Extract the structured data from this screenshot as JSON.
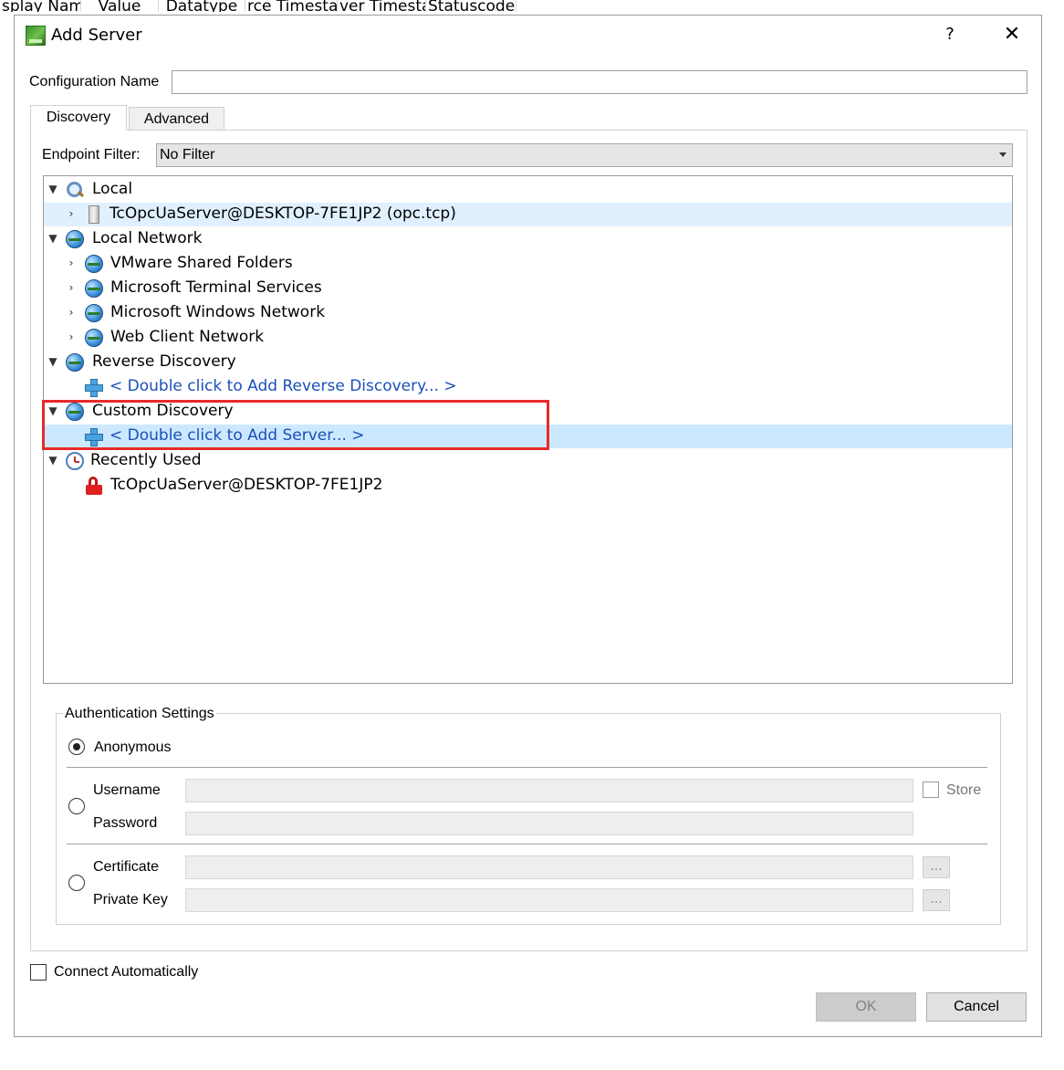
{
  "background_headers": [
    "splay Nam",
    "Value",
    "Datatype",
    "rce Timesta",
    "ver Timesta",
    "Statuscode"
  ],
  "dialog": {
    "title": "Add Server",
    "help_label": "?",
    "close_label": "✕"
  },
  "configuration": {
    "label": "Configuration Name",
    "value": ""
  },
  "tabs": [
    {
      "label": "Discovery",
      "active": true
    },
    {
      "label": "Advanced",
      "active": false
    }
  ],
  "endpoint_filter": {
    "label": "Endpoint Filter:",
    "value": "No Filter"
  },
  "tree": {
    "local": {
      "label": "Local",
      "icon": "magnifier-icon"
    },
    "local_server": {
      "label": "TcOpcUaServer@DESKTOP-7FE1JP2 (opc.tcp)",
      "icon": "server-icon"
    },
    "local_network": {
      "label": "Local Network",
      "icon": "globe-icon"
    },
    "network_items": [
      {
        "label": "VMware Shared Folders",
        "icon": "globe-icon"
      },
      {
        "label": "Microsoft Terminal Services",
        "icon": "globe-icon"
      },
      {
        "label": "Microsoft Windows Network",
        "icon": "globe-icon"
      },
      {
        "label": "Web Client Network",
        "icon": "globe-icon"
      }
    ],
    "reverse_discovery": {
      "label": "Reverse Discovery",
      "icon": "globe-icon"
    },
    "reverse_add": {
      "label": "< Double click to Add Reverse Discovery... >",
      "icon": "plus-icon"
    },
    "custom_discovery": {
      "label": "Custom Discovery",
      "icon": "globe-icon"
    },
    "custom_add": {
      "label": "< Double click to Add Server... >",
      "icon": "plus-icon"
    },
    "recently_used": {
      "label": "Recently Used",
      "icon": "clock-icon"
    },
    "recent_server": {
      "label": "TcOpcUaServer@DESKTOP-7FE1JP2",
      "icon": "lock-icon"
    }
  },
  "auth": {
    "title": "Authentication Settings",
    "anonymous": "Anonymous",
    "username": "Username",
    "password": "Password",
    "store": "Store",
    "certificate": "Certificate",
    "private_key": "Private Key",
    "browse": "..."
  },
  "connect_auto": "Connect Automatically",
  "buttons": {
    "ok": "OK",
    "cancel": "Cancel"
  },
  "colors": {
    "annotation": "#e62a2a",
    "selection": "#cce8ff",
    "link": "#1a50b8"
  }
}
